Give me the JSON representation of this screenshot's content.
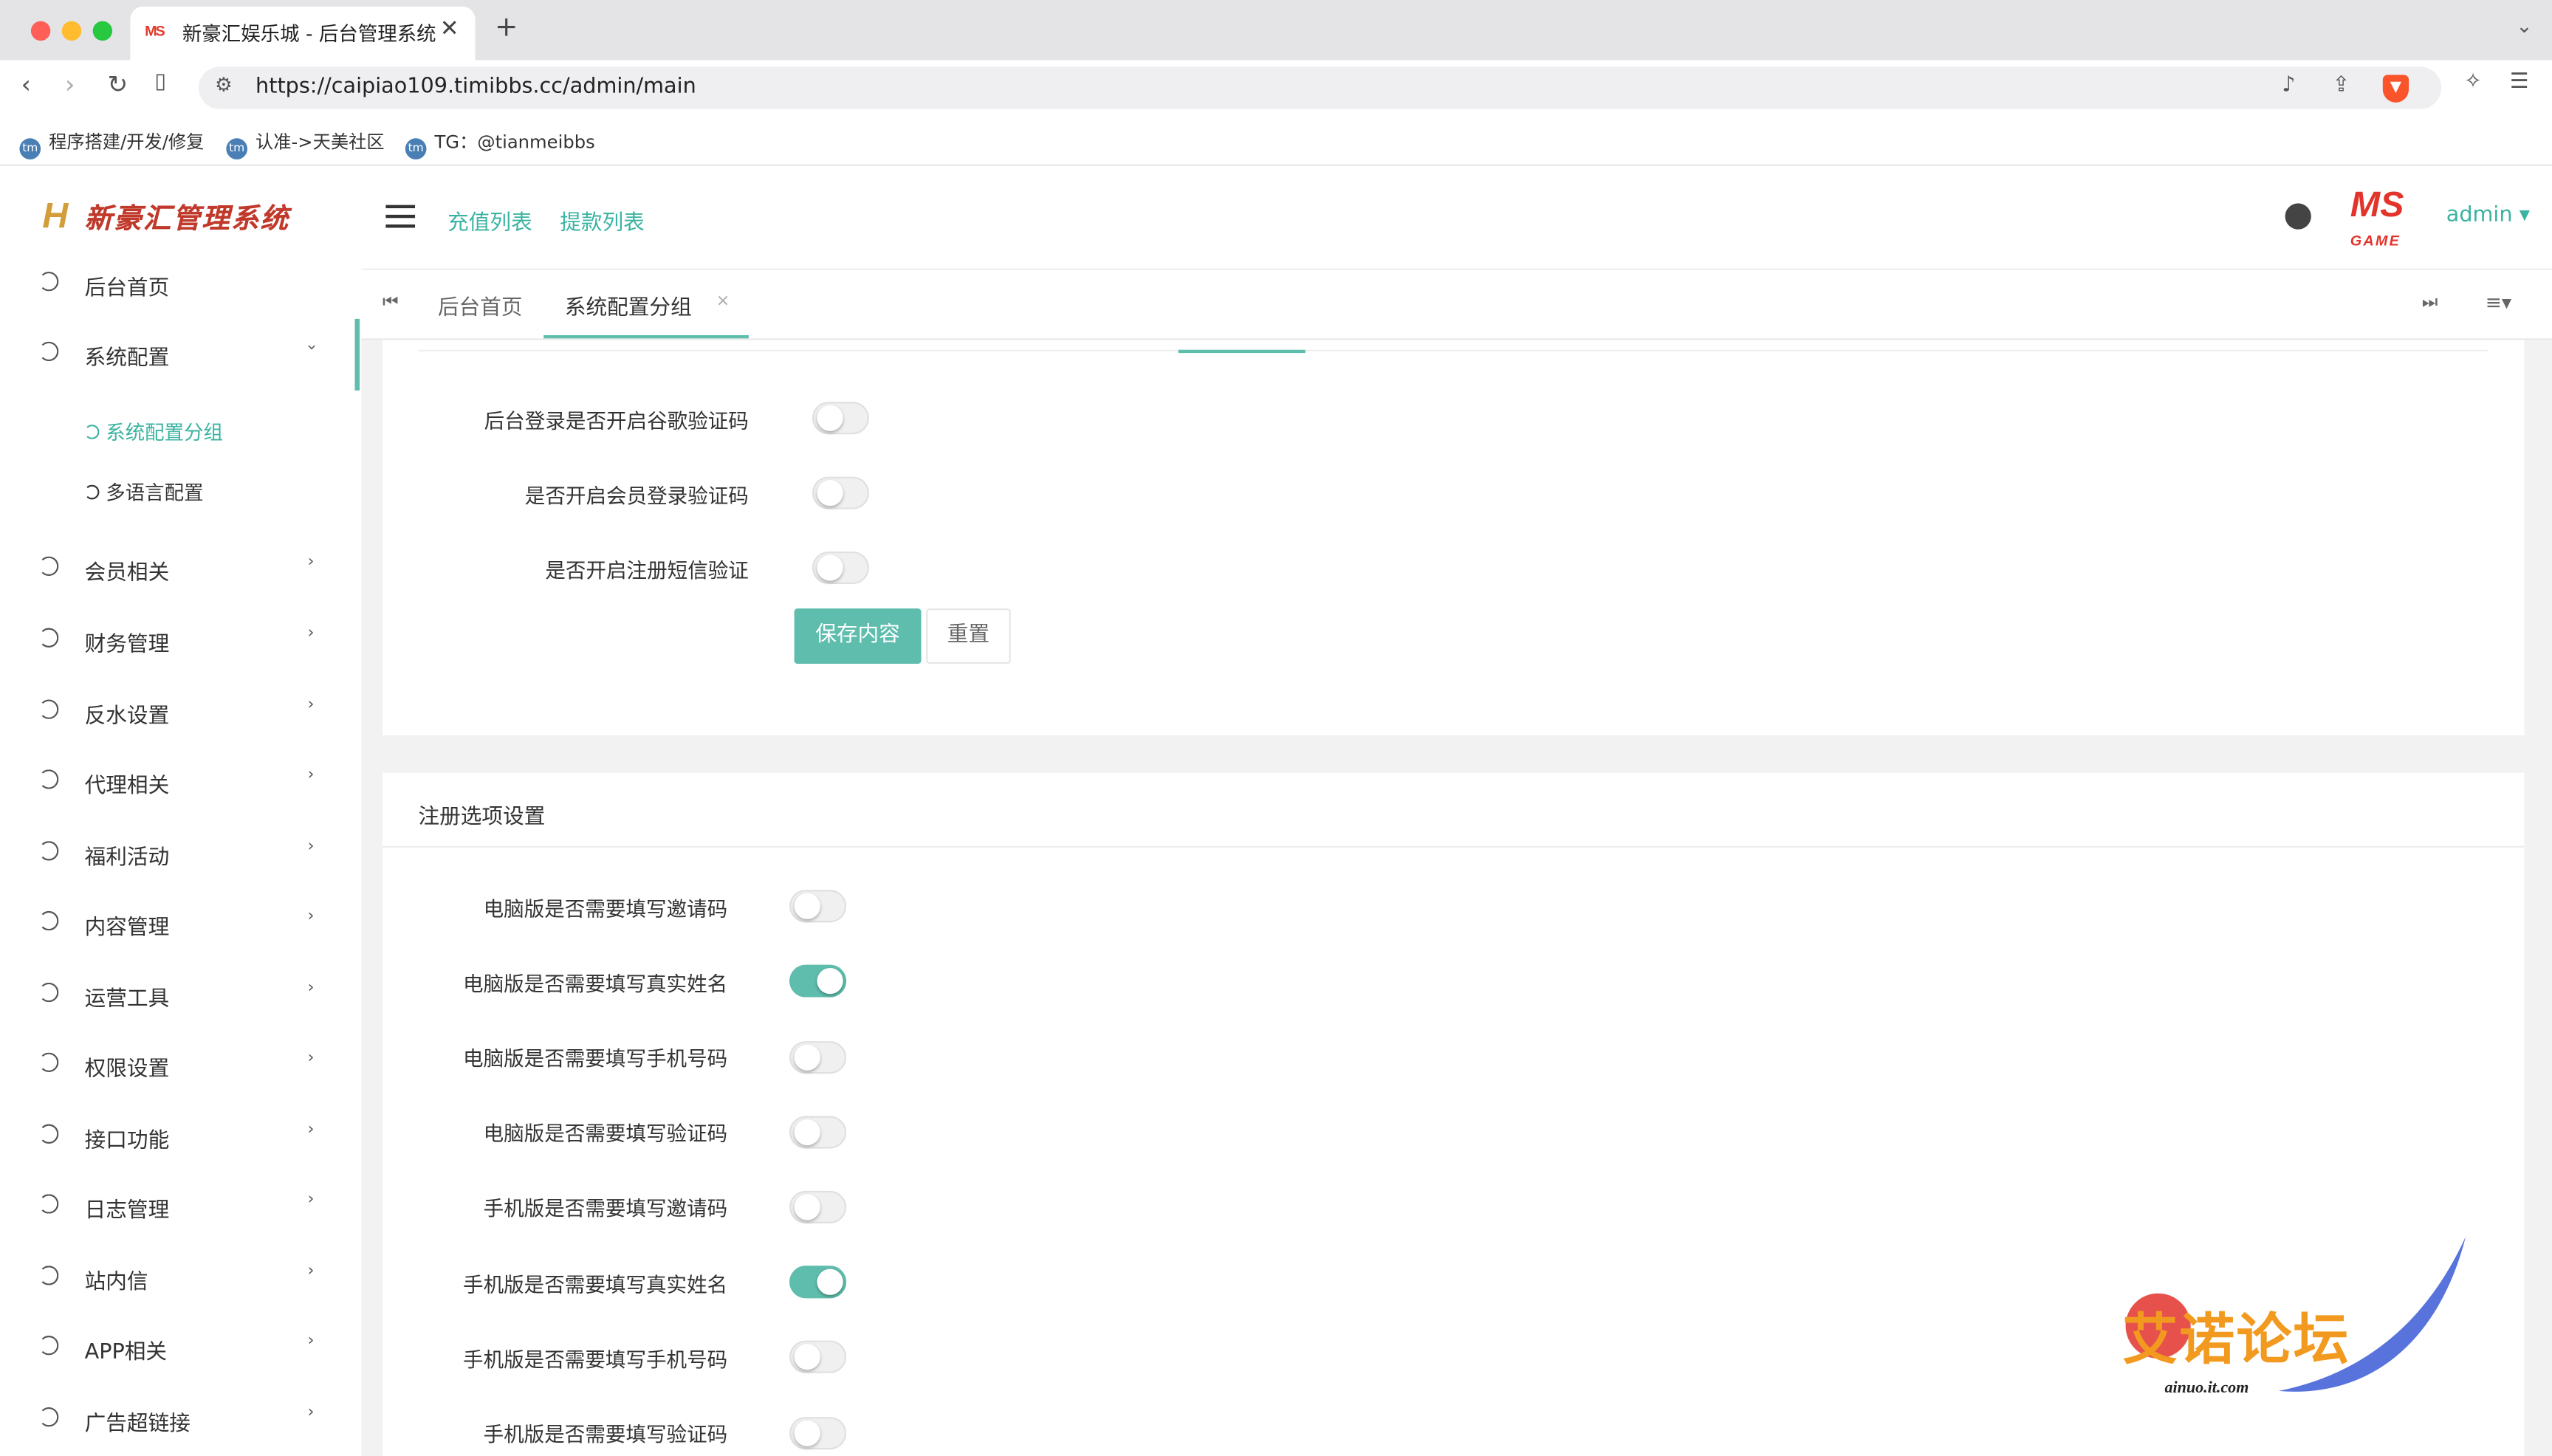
{
  "browser": {
    "tab_title": "新豪汇娱乐城 - 后台管理系统",
    "tab_favicon": "MS",
    "new_tab_label": "+",
    "url": "https://caipiao109.timibbs.cc/admin/main",
    "bookmarks": [
      {
        "label": "程序搭建/开发/修复"
      },
      {
        "label": "认准->天美社区"
      },
      {
        "label": "TG：@tianmeibbs"
      }
    ]
  },
  "sidebar": {
    "logo_text": "新豪汇管理系统",
    "items": [
      {
        "label": "后台首页"
      },
      {
        "label": "系统配置"
      },
      {
        "label": "会员相关"
      },
      {
        "label": "财务管理"
      },
      {
        "label": "反水设置"
      },
      {
        "label": "代理相关"
      },
      {
        "label": "福利活动"
      },
      {
        "label": "内容管理"
      },
      {
        "label": "运营工具"
      },
      {
        "label": "权限设置"
      },
      {
        "label": "接口功能"
      },
      {
        "label": "日志管理"
      },
      {
        "label": "站内信"
      },
      {
        "label": "APP相关"
      },
      {
        "label": "广告超链接"
      }
    ],
    "submenu": [
      {
        "label": "系统配置分组",
        "active": true
      },
      {
        "label": "多语言配置",
        "active": false
      }
    ],
    "accent_color": "#5fbdad"
  },
  "header": {
    "links": [
      "充值列表",
      "提款列表"
    ],
    "brand_badge": "MS",
    "brand_badge_sub": "GAME",
    "user": "admin"
  },
  "page_tabs": [
    {
      "label": "后台首页"
    },
    {
      "label": "系统配置分组",
      "active": true,
      "close": "×"
    }
  ],
  "settings_top": [
    {
      "label": "后台登录是否开启谷歌验证码",
      "on": false
    },
    {
      "label": "是否开启会员登录验证码",
      "on": false
    },
    {
      "label": "是否开启注册短信验证",
      "on": false
    }
  ],
  "buttons": {
    "save": "保存内容",
    "reset": "重置"
  },
  "register_section": {
    "title": "注册选项设置",
    "fields": [
      {
        "label": "电脑版是否需要填写邀请码",
        "on": false
      },
      {
        "label": "电脑版是否需要填写真实姓名",
        "on": true
      },
      {
        "label": "电脑版是否需要填写手机号码",
        "on": false
      },
      {
        "label": "电脑版是否需要填写验证码",
        "on": false
      },
      {
        "label": "手机版是否需要填写邀请码",
        "on": false
      },
      {
        "label": "手机版是否需要填写真实姓名",
        "on": true
      },
      {
        "label": "手机版是否需要填写手机号码",
        "on": false
      },
      {
        "label": "手机版是否需要填写验证码",
        "on": false
      }
    ]
  },
  "watermark": {
    "text": "艾诺论坛",
    "url": "ainuo.it.com"
  }
}
